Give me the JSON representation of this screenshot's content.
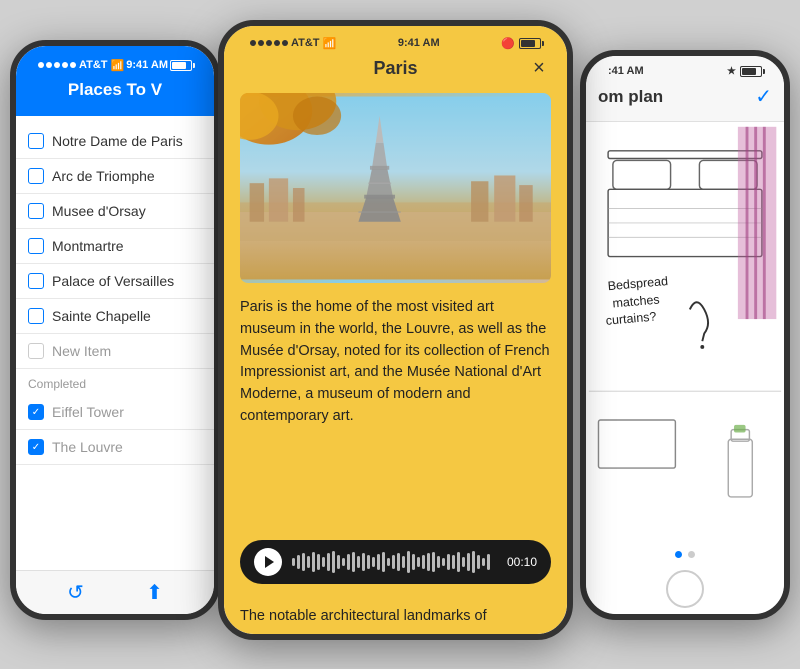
{
  "left_phone": {
    "status": {
      "carrier": "AT&T",
      "signal_bars": 5,
      "wifi": "WiFi",
      "time": "9:41 AM"
    },
    "title": "Places To V",
    "todo_items": [
      {
        "id": "notre-dame",
        "label": "Notre Dame de Paris",
        "checked": false
      },
      {
        "id": "arc-de-triomphe",
        "label": "Arc de Triomphe",
        "checked": false
      },
      {
        "id": "musee-dorsay",
        "label": "Musee d'Orsay",
        "checked": false
      },
      {
        "id": "montmartre",
        "label": "Montmartre",
        "checked": false
      },
      {
        "id": "palace-of-versailles",
        "label": "Palace of Versailles",
        "checked": false
      },
      {
        "id": "sainte-chapelle",
        "label": "Sainte Chapelle",
        "checked": false
      },
      {
        "id": "new-item",
        "label": "New Item",
        "checked": false,
        "new": true
      }
    ],
    "completed_label": "Completed",
    "completed_items": [
      {
        "id": "eiffel-tower",
        "label": "Eiffel Tower",
        "checked": true
      },
      {
        "id": "the-louvre",
        "label": "The Louvre",
        "checked": true
      }
    ]
  },
  "center_phone": {
    "status": {
      "carrier": "AT&T",
      "time": "9:41 AM"
    },
    "title": "Paris",
    "close_button": "×",
    "description": "Paris is the home of the most visited art museum in the world, the Louvre, as well as the Musée d'Orsay, noted for its collection of French Impressionist art, and the Musée National d'Art Moderne, a museum of modern and contemporary art.",
    "audio": {
      "time": "00:10"
    },
    "notable_text": "The notable architectural landmarks of"
  },
  "right_phone": {
    "status": {
      "time": ":41 AM"
    },
    "title": "om plan",
    "checkmark": "✓",
    "sketch_note": "Bedspread matches curtains?",
    "pager_dots": [
      "active",
      "inactive"
    ]
  },
  "colors": {
    "blue": "#007AFF",
    "yellow": "#F5C842",
    "dark": "#1a1a1a",
    "checked_bg": "#007AFF"
  }
}
